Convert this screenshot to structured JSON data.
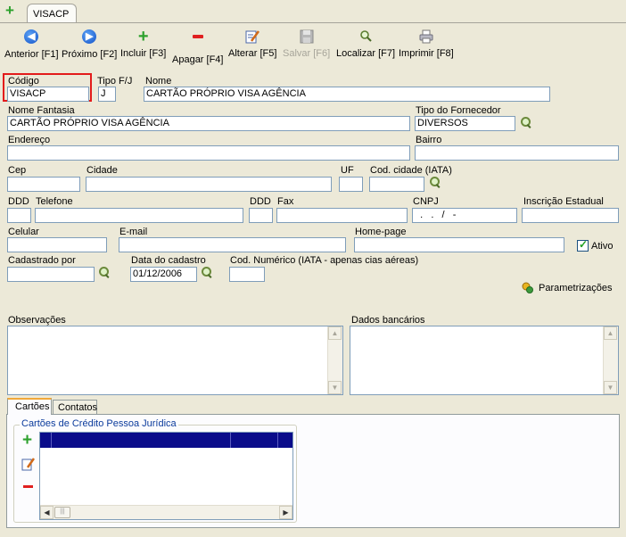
{
  "tab": {
    "new_icon": "plus-icon",
    "label": "VISACP"
  },
  "toolbar": [
    {
      "label": "Anterior [F1]",
      "icon": "arrow-left-icon",
      "enabled": true
    },
    {
      "label": "Próximo [F2]",
      "icon": "arrow-right-icon",
      "enabled": true
    },
    {
      "label": "Incluir [F3]",
      "icon": "plus-icon",
      "enabled": true
    },
    {
      "label": "Apagar [F4]",
      "icon": "minus-icon",
      "enabled": true
    },
    {
      "label": "Alterar [F5]",
      "icon": "edit-icon",
      "enabled": true
    },
    {
      "label": "Salvar [F6]",
      "icon": "save-icon",
      "enabled": false
    },
    {
      "label": "Localizar [F7]",
      "icon": "search-icon",
      "enabled": true
    },
    {
      "label": "Imprimir [F8]",
      "icon": "printer-icon",
      "enabled": true
    }
  ],
  "form": {
    "codigo": {
      "label": "Código",
      "value": "VISACP"
    },
    "tipo_fj": {
      "label": "Tipo F/J",
      "value": "J"
    },
    "nome": {
      "label": "Nome",
      "value": "CARTÃO PRÓPRIO VISA AGÊNCIA"
    },
    "nome_fantasia": {
      "label": "Nome Fantasia",
      "value": "CARTÃO PRÓPRIO VISA AGÊNCIA"
    },
    "tipo_fornecedor": {
      "label": "Tipo do Fornecedor",
      "value": "DIVERSOS"
    },
    "endereco": {
      "label": "Endereço",
      "value": ""
    },
    "bairro": {
      "label": "Bairro",
      "value": ""
    },
    "cep": {
      "label": "Cep",
      "value": ""
    },
    "cidade": {
      "label": "Cidade",
      "value": ""
    },
    "uf": {
      "label": "UF",
      "value": ""
    },
    "cod_cidade": {
      "label": "Cod. cidade (IATA)",
      "value": ""
    },
    "ddd1": {
      "label": "DDD",
      "value": ""
    },
    "telefone": {
      "label": "Telefone",
      "value": ""
    },
    "ddd2": {
      "label": "DDD",
      "value": ""
    },
    "fax": {
      "label": "Fax",
      "value": ""
    },
    "cnpj": {
      "label": "CNPJ",
      "value": "  .   .   /   -"
    },
    "inscricao_estadual": {
      "label": "Inscrição Estadual",
      "value": ""
    },
    "celular": {
      "label": "Celular",
      "value": ""
    },
    "email": {
      "label": "E-mail",
      "value": ""
    },
    "homepage": {
      "label": "Home-page",
      "value": ""
    },
    "ativo": {
      "label": "Ativo",
      "checked": true
    },
    "cadastrado_por": {
      "label": "Cadastrado por",
      "value": ""
    },
    "data_cadastro": {
      "label": "Data do cadastro",
      "value": "01/12/2006"
    },
    "cod_numerico": {
      "label": "Cod. Numérico (IATA - apenas cias aéreas)",
      "value": ""
    },
    "parametrizacoes": {
      "label": "Parametrizações"
    },
    "observacoes": {
      "label": "Observações",
      "value": ""
    },
    "dados_bancarios": {
      "label": "Dados bancários",
      "value": ""
    }
  },
  "bottom_tabs": [
    {
      "label": "Cartões",
      "active": true
    },
    {
      "label": "Contatos",
      "active": false
    }
  ],
  "cartoes": {
    "group_title": "Cartões de Crédito Pessoa Jurídica"
  },
  "colors": {
    "highlight": "#e31b1b",
    "grid_header": "#0a0c8a",
    "group_title": "#0b3b9c"
  }
}
